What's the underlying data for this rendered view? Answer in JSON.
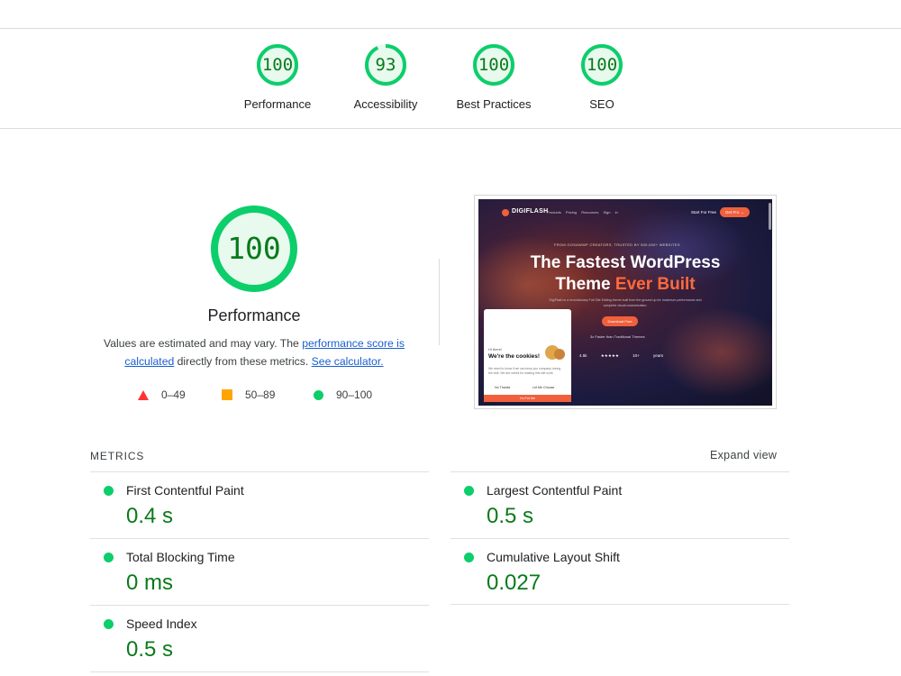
{
  "top_gauges": [
    {
      "label": "Performance",
      "score": "100",
      "fraction": 1.0
    },
    {
      "label": "Accessibility",
      "score": "93",
      "fraction": 0.93
    },
    {
      "label": "Best Practices",
      "score": "100",
      "fraction": 1.0
    },
    {
      "label": "SEO",
      "score": "100",
      "fraction": 1.0
    }
  ],
  "performance": {
    "score": "100",
    "fraction": 1.0,
    "title": "Performance",
    "note_prefix": "Values are estimated and may vary. The ",
    "note_link": "performance score is calculated",
    "note_middle": " directly from these metrics. ",
    "note_link2": "See calculator."
  },
  "legend": [
    {
      "shape": "triangle",
      "range": "0–49",
      "color": "#ff3333"
    },
    {
      "shape": "square",
      "range": "50–89",
      "color": "#ffa400"
    },
    {
      "shape": "circle",
      "range": "90–100",
      "color": "#0cce6b"
    }
  ],
  "screenshot": {
    "brand": "DIGIFLASH",
    "nav": "Products Pricing Resources Sign in",
    "start_free": "Start For Free",
    "get_pro": "Get Pro →",
    "badge": "FROM GOSAWWP CREATORS, TRUSTED BY 500,000+ WEBSITES",
    "headline_1": "The Fastest WordPress",
    "headline_2a": "Theme ",
    "headline_2b": "Ever Built",
    "subtext": "DigiFlash is a revolutionary Full Site Editing theme built from the ground up for maximum performance and complete visual customization.",
    "download": "Download Free",
    "faster": "3x Faster than Traditional Themes",
    "stats": "4.5k ★★★★★ 10+ years",
    "cookie": {
      "hi": "Hi there!",
      "title": "We're the cookies!",
      "text": "We need to know if we can keep you company during the visit. We are useful for making this site work.",
      "no_thanks": "No Thanks",
      "let_me": "Let Me Choose",
      "im_for": "I'm For Me"
    }
  },
  "metrics": {
    "title": "METRICS",
    "expand": "Expand view",
    "items": [
      {
        "name": "First Contentful Paint",
        "value": "0.4 s"
      },
      {
        "name": "Largest Contentful Paint",
        "value": "0.5 s"
      },
      {
        "name": "Total Blocking Time",
        "value": "0 ms"
      },
      {
        "name": "Cumulative Layout Shift",
        "value": "0.027"
      },
      {
        "name": "Speed Index",
        "value": "0.5 s"
      }
    ]
  },
  "colors": {
    "pass_ring": "#0cce6b",
    "pass_fill": "#e8f9ee",
    "pass_text": "#0a7a1a",
    "link": "#1a5fd0"
  }
}
